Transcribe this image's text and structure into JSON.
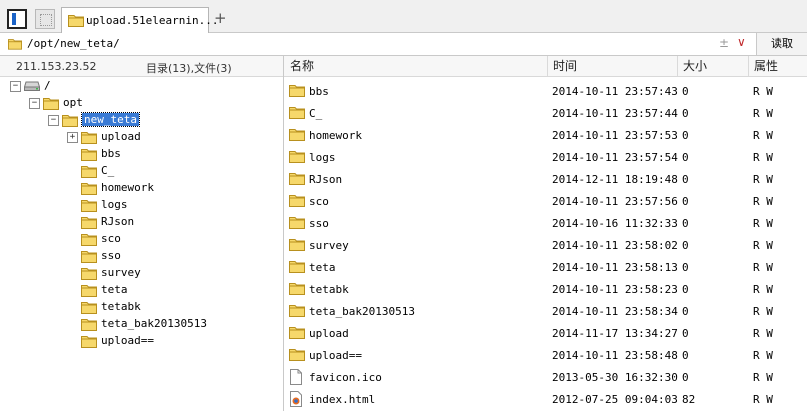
{
  "tabbar": {
    "panel_icon": "panel-toggle-icon",
    "blank_icon": "blank-tab-icon",
    "active_tab_label": "upload.51elearnin...",
    "add_tab_label": "+"
  },
  "address": {
    "path": "/opt/new_teta/",
    "star_icon": "±",
    "dropdown_icon": "∨",
    "read_button": "读取"
  },
  "left": {
    "host": "211.153.23.52",
    "summary": "目录(13),文件(3)",
    "tree": [
      {
        "label": "/",
        "toggle": "−"
      },
      {
        "label": "opt",
        "toggle": "−"
      },
      {
        "label": "new_teta",
        "toggle": "−",
        "selected": true
      },
      {
        "label": "upload",
        "toggle": "+"
      },
      {
        "label": "bbs"
      },
      {
        "label": "C_"
      },
      {
        "label": "homework"
      },
      {
        "label": "logs"
      },
      {
        "label": "RJson"
      },
      {
        "label": "sco"
      },
      {
        "label": "sso"
      },
      {
        "label": "survey"
      },
      {
        "label": "teta"
      },
      {
        "label": "tetabk"
      },
      {
        "label": "teta_bak20130513"
      },
      {
        "label": "upload=="
      }
    ]
  },
  "list": {
    "headers": {
      "name": "名称",
      "time": "时间",
      "size": "大小",
      "attr": "属性"
    },
    "rows": [
      {
        "name": "bbs",
        "time": "2014-10-11 23:57:43",
        "size": "0",
        "attr": "R W",
        "icon": "folder-icon"
      },
      {
        "name": "C_",
        "time": "2014-10-11 23:57:44",
        "size": "0",
        "attr": "R W",
        "icon": "folder-icon"
      },
      {
        "name": "homework",
        "time": "2014-10-11 23:57:53",
        "size": "0",
        "attr": "R W",
        "icon": "folder-icon"
      },
      {
        "name": "logs",
        "time": "2014-10-11 23:57:54",
        "size": "0",
        "attr": "R W",
        "icon": "folder-icon"
      },
      {
        "name": "RJson",
        "time": "2014-12-11 18:19:48",
        "size": "0",
        "attr": "R W",
        "icon": "folder-icon"
      },
      {
        "name": "sco",
        "time": "2014-10-11 23:57:56",
        "size": "0",
        "attr": "R W",
        "icon": "folder-icon"
      },
      {
        "name": "sso",
        "time": "2014-10-16 11:32:33",
        "size": "0",
        "attr": "R W",
        "icon": "folder-icon"
      },
      {
        "name": "survey",
        "time": "2014-10-11 23:58:02",
        "size": "0",
        "attr": "R W",
        "icon": "folder-icon"
      },
      {
        "name": "teta",
        "time": "2014-10-11 23:58:13",
        "size": "0",
        "attr": "R W",
        "icon": "folder-icon"
      },
      {
        "name": "tetabk",
        "time": "2014-10-11 23:58:23",
        "size": "0",
        "attr": "R W",
        "icon": "folder-icon"
      },
      {
        "name": "teta_bak20130513",
        "time": "2014-10-11 23:58:34",
        "size": "0",
        "attr": "R W",
        "icon": "folder-icon"
      },
      {
        "name": "upload",
        "time": "2014-11-17 13:34:27",
        "size": "0",
        "attr": "R W",
        "icon": "folder-icon"
      },
      {
        "name": "upload==",
        "time": "2014-10-11 23:58:48",
        "size": "0",
        "attr": "R W",
        "icon": "folder-icon"
      },
      {
        "name": "favicon.ico",
        "time": "2013-05-30 16:32:30",
        "size": "0",
        "attr": "R W",
        "icon": "file-icon"
      },
      {
        "name": "index.html",
        "time": "2012-07-25 09:04:03",
        "size": "82",
        "attr": "R W",
        "icon": "html-file-icon"
      }
    ]
  }
}
